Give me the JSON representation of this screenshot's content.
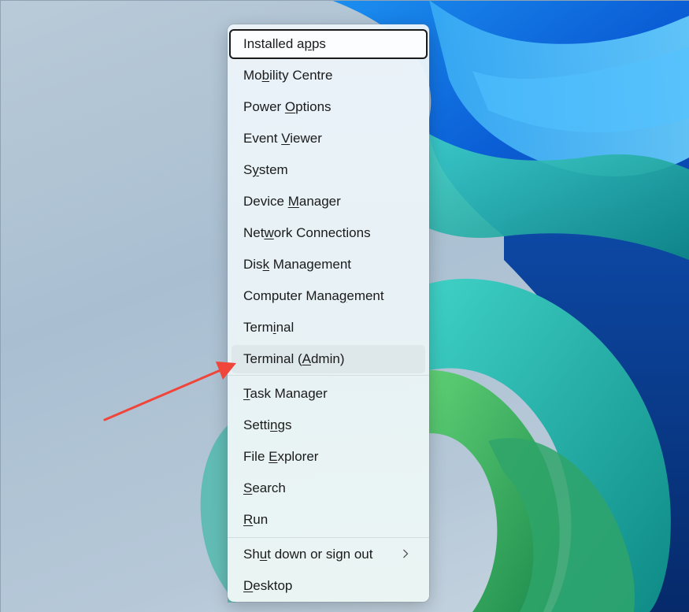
{
  "context_menu": {
    "items": [
      {
        "before": "Installed a",
        "key": "p",
        "after": "ps",
        "state": "focused"
      },
      {
        "before": "Mo",
        "key": "b",
        "after": "ility Centre"
      },
      {
        "before": "Power ",
        "key": "O",
        "after": "ptions"
      },
      {
        "before": "Event ",
        "key": "V",
        "after": "iewer"
      },
      {
        "before": "S",
        "key": "y",
        "after": "stem"
      },
      {
        "before": "Device ",
        "key": "M",
        "after": "anager"
      },
      {
        "before": "Net",
        "key": "w",
        "after": "ork Connections"
      },
      {
        "before": "Dis",
        "key": "k",
        "after": " Management"
      },
      {
        "before": "Computer Mana",
        "key": "g",
        "after": "ement"
      },
      {
        "before": "Term",
        "key": "i",
        "after": "nal"
      },
      {
        "before": "Terminal (",
        "key": "A",
        "after": "dmin)",
        "state": "hovered"
      },
      {
        "before": "",
        "key": "T",
        "after": "ask Manager"
      },
      {
        "before": "Setti",
        "key": "n",
        "after": "gs"
      },
      {
        "before": "File ",
        "key": "E",
        "after": "xplorer"
      },
      {
        "before": "",
        "key": "S",
        "after": "earch"
      },
      {
        "before": "",
        "key": "R",
        "after": "un"
      },
      {
        "before": "Sh",
        "key": "u",
        "after": "t down or sign out",
        "submenu": true
      },
      {
        "before": "",
        "key": "D",
        "after": "esktop"
      }
    ]
  },
  "icons": {
    "submenu_chevron": "chevron-right-icon",
    "annotation": "arrow-icon"
  },
  "colors": {
    "annotation_arrow": "#f0453a",
    "focus_outline": "#1a1a1a",
    "menu_text": "#1b1b1b"
  }
}
